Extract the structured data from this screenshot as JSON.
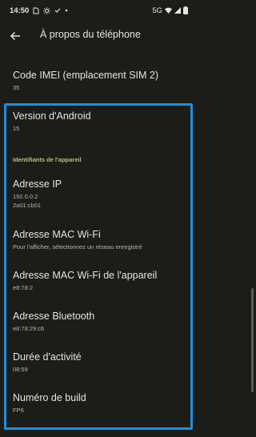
{
  "status_bar": {
    "time": "14:50",
    "network": "5G",
    "icons": [
      "sim-icon",
      "brightness-icon",
      "check-icon",
      "dot-icon",
      "wifi-icon",
      "signal-icon",
      "battery-icon"
    ]
  },
  "app_bar": {
    "title": "À propos du téléphone",
    "back_icon": "arrow-back-icon"
  },
  "preferences": [
    {
      "title": "Code IMEI (emplacement SIM 2)",
      "summary": "35"
    },
    {
      "title": "Version d'Android",
      "summary": "15"
    },
    {
      "title": "Adresse IP",
      "summary": "192.0.0.2\n2a01:cb01"
    },
    {
      "title": "Adresse MAC Wi-Fi",
      "summary": "Pour l'afficher, sélectionnez un réseau enregistré"
    },
    {
      "title": "Adresse MAC Wi-Fi de l'appareil",
      "summary": "e8:78:2"
    },
    {
      "title": "Adresse Bluetooth",
      "summary": "e8:78:29:c6"
    },
    {
      "title": "Durée d'activité",
      "summary": "08:59"
    },
    {
      "title": "Numéro de build",
      "summary": "FP6"
    }
  ],
  "category_label": "Identifiants de l'appareil",
  "colors": {
    "background": "#1c1d18",
    "accent_category": "#a9c97c",
    "highlight": "#1d8fe1"
  }
}
